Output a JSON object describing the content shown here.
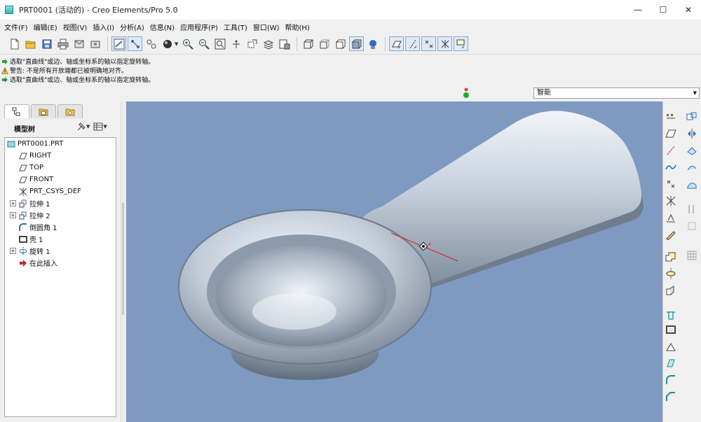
{
  "window": {
    "title": "PRT0001 (活动的) - Creo Elements/Pro 5.0",
    "controls": [
      "—",
      "☐",
      "✕"
    ]
  },
  "menu": [
    "文件(F)",
    "编辑(E)",
    "视图(V)",
    "插入(I)",
    "分析(A)",
    "信息(N)",
    "应用程序(P)",
    "工具(T)",
    "窗口(W)",
    "帮助(H)"
  ],
  "messages": [
    {
      "type": "prompt",
      "text": "选取\"直曲线\"或边、轴或坐标系的轴以指定旋转轴。"
    },
    {
      "type": "warning",
      "text": "警告: 不是所有开放端都已被明确地对齐。"
    },
    {
      "type": "prompt",
      "text": "选取\"直曲线\"或边、轴或坐标系的轴以指定旋转轴。"
    }
  ],
  "filter": {
    "value": "智能"
  },
  "model_tree": {
    "title": "模型树",
    "items": [
      {
        "label": "PRT0001.PRT",
        "icon": "part-icon"
      },
      {
        "label": "RIGHT",
        "icon": "datum-plane-icon"
      },
      {
        "label": "TOP",
        "icon": "datum-plane-icon"
      },
      {
        "label": "FRONT",
        "icon": "datum-plane-icon"
      },
      {
        "label": "PRT_CSYS_DEF",
        "icon": "csys-icon"
      },
      {
        "label": "拉伸 1",
        "icon": "extrude-icon"
      },
      {
        "label": "拉伸 2",
        "icon": "extrude-icon"
      },
      {
        "label": "倒圆角 1",
        "icon": "round-icon"
      },
      {
        "label": "壳 1",
        "icon": "shell-icon"
      },
      {
        "label": "旋转 1",
        "icon": "revolve-icon"
      },
      {
        "label": "在此插入",
        "icon": "insert-here-icon"
      }
    ]
  },
  "colors": {
    "viewport_bg": "#7f9ac0",
    "model_surface": "#c9d3de",
    "axis_line": "#d22020"
  }
}
